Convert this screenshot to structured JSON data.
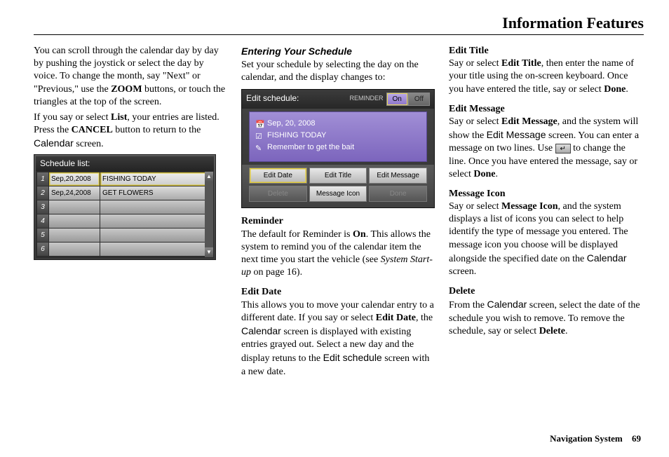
{
  "header": {
    "title": "Information Features"
  },
  "col1": {
    "p1a": "You can scroll through the calendar day by day by pushing the joystick or select the day by voice. To change the month, say \"Next\" or \"Previous,\" use the ",
    "zoom": "ZOOM",
    "p1b": " buttons, or touch the triangles at the top of the screen.",
    "p2a": "If you say or select ",
    "list": "List",
    "p2b": ", your entries are listed. Press the ",
    "cancel": "CANCEL",
    "p2c": " button to return to the ",
    "calendar": "Calendar",
    "p2d": " screen.",
    "sched_title": "Schedule list:",
    "rows": [
      {
        "n": "1",
        "date": "Sep,20,2008",
        "text": "FISHING TODAY"
      },
      {
        "n": "2",
        "date": "Sep,24,2008",
        "text": "GET FLOWERS"
      },
      {
        "n": "3",
        "date": "",
        "text": ""
      },
      {
        "n": "4",
        "date": "",
        "text": ""
      },
      {
        "n": "5",
        "date": "",
        "text": ""
      },
      {
        "n": "6",
        "date": "",
        "text": ""
      }
    ]
  },
  "col2": {
    "h": "Entering Your Schedule",
    "p1": "Set your schedule by selecting the day on the calendar, and the display changes to:",
    "edit": {
      "title": "Edit schedule:",
      "reminder_label": "REMINDER",
      "on": "On",
      "off": "Off",
      "date": "Sep, 20, 2008",
      "line1": "FISHING TODAY",
      "line2": "Remember to get the bait",
      "btn_edit_date": "Edit Date",
      "btn_edit_title": "Edit Title",
      "btn_edit_message": "Edit Message",
      "btn_delete": "Delete",
      "btn_message_icon": "Message Icon",
      "btn_done": "Done"
    },
    "reminder_h": "Reminder",
    "reminder_a": "The default for Reminder is ",
    "reminder_on": "On",
    "reminder_b": ". This allows the system to remind you of the calendar item the next time you start the vehicle (see ",
    "reminder_sys": "System Start-up",
    "reminder_c": " on page 16).",
    "editdate_h": "Edit Date",
    "editdate_a": "This allows you to move your calendar entry to a different date. If you say or select ",
    "editdate_b": "Edit Date",
    "editdate_c": ", the ",
    "editdate_d": "Calendar",
    "editdate_e": " screen is displayed with existing entries grayed out. Select a new day and the display retuns to the ",
    "editdate_f": "Edit schedule",
    "editdate_g": " screen with a new date."
  },
  "col3": {
    "et_h": "Edit Title",
    "et_a": "Say or select ",
    "et_b": "Edit Title",
    "et_c": ", then enter the name of your title using the on-screen keyboard. Once you have entered the title, say or select ",
    "et_d": "Done",
    "et_e": ".",
    "em_h": "Edit Message",
    "em_a": "Say or select ",
    "em_b": "Edit Message",
    "em_c": ", and the system will show the ",
    "em_d": "Edit Message",
    "em_e": " screen. You can enter a message on two lines. Use ",
    "em_ret": "↵",
    "em_f": " to change the line. Once you have entered the message, say or select ",
    "em_g": "Done",
    "em_h2": ".",
    "mi_h": "Message Icon",
    "mi_a": "Say or select ",
    "mi_b": "Message Icon",
    "mi_c": ", and the system displays a list of icons you can select to help identify the type of message you entered. The message icon you choose will be displayed alongside the specified date on the ",
    "mi_d": "Calendar",
    "mi_e": " screen.",
    "del_h": "Delete",
    "del_a": "From the ",
    "del_b": "Calendar",
    "del_c": " screen, select the date of the schedule you wish to remove. To remove the schedule, say or select ",
    "del_d": "Delete",
    "del_e": "."
  },
  "footer": {
    "nav": "Navigation System",
    "page": "69"
  }
}
